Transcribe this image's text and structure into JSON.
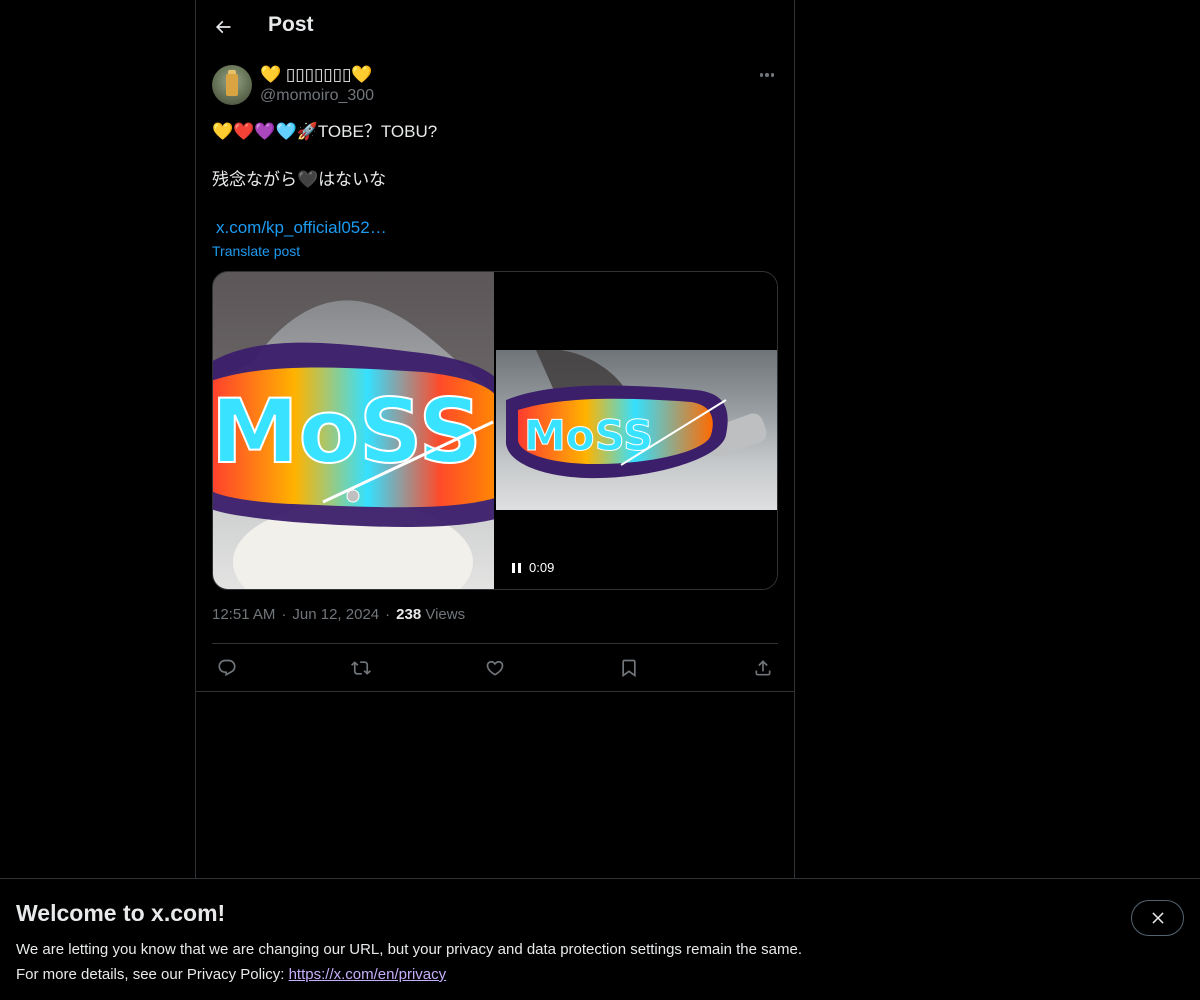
{
  "header": {
    "title": "Post",
    "back_icon": "arrow-left-icon"
  },
  "author": {
    "display_name": "💛 ▯▯▯▯▯▯▯💛",
    "handle": "@momoiro_300"
  },
  "post": {
    "line1": "💛❤️💜🩵🚀TOBE？TOBU?",
    "line2": "残念ながら🖤はないな",
    "link_text": "x.com/kp_official052…",
    "translate_label": "Translate post"
  },
  "media": {
    "video_duration": "0:09",
    "overlay_text_left": "MoSS",
    "overlay_text_right": "MoSS"
  },
  "meta": {
    "time": "12:51 AM",
    "date": "Jun 12, 2024",
    "views_count": "238",
    "views_label": "Views",
    "separator": "·"
  },
  "actions": {
    "icons": [
      "reply-icon",
      "retweet-icon",
      "like-icon",
      "bookmark-icon",
      "share-icon"
    ]
  },
  "banner": {
    "title": "Welcome to x.com!",
    "line1": "We are letting you know that we are changing our URL, but your privacy and data protection settings remain the same.",
    "line2_prefix": "For more details, see our Privacy Policy: ",
    "link": "https://x.com/en/privacy"
  },
  "colors": {
    "background": "#000000",
    "text": "#e7e9ea",
    "muted": "#71767b",
    "accent": "#1d9bf0",
    "border": "#2f3336",
    "banner_link": "#c5aefb"
  }
}
